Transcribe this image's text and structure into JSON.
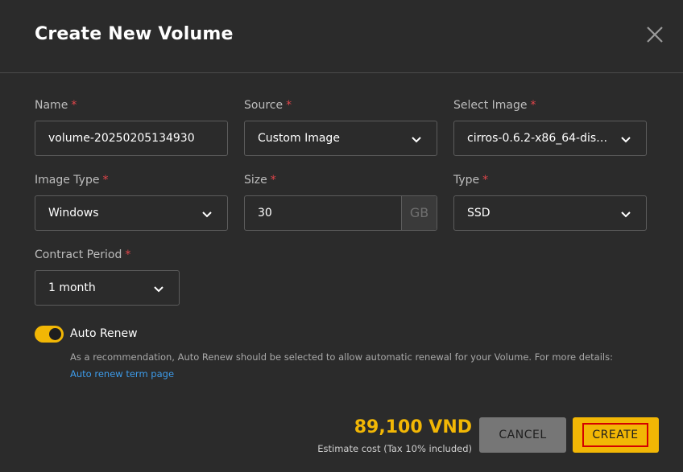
{
  "dialog": {
    "title": "Create New Volume"
  },
  "form": {
    "name": {
      "label": "Name",
      "required_mark": "*",
      "value": "volume-20250205134930"
    },
    "source": {
      "label": "Source",
      "required_mark": "*",
      "value": "Custom Image"
    },
    "select_image": {
      "label": "Select Image",
      "required_mark": "*",
      "value": "cirros-0.6.2-x86_64-disk..."
    },
    "image_type": {
      "label": "Image Type",
      "required_mark": "*",
      "value": "Windows"
    },
    "size": {
      "label": "Size",
      "required_mark": "*",
      "value": "30",
      "unit": "GB"
    },
    "type": {
      "label": "Type",
      "required_mark": "*",
      "value": "SSD"
    },
    "contract_period": {
      "label": "Contract Period",
      "required_mark": "*",
      "value": "1 month"
    }
  },
  "auto_renew": {
    "label": "Auto Renew",
    "enabled": true,
    "hint": "As a recommendation, Auto Renew should be selected to allow automatic renewal for your Volume. For more details: ",
    "link_text": "Auto renew term page"
  },
  "footer": {
    "price": "89,100 VND",
    "price_note": "Estimate cost (Tax 10% included)",
    "cancel_label": "CANCEL",
    "create_label": "CREATE"
  },
  "colors": {
    "accent": "#f2b705",
    "required": "#e0454a",
    "link": "#3d9be9",
    "background": "#2b2b2b",
    "highlight_border": "#d40000"
  }
}
